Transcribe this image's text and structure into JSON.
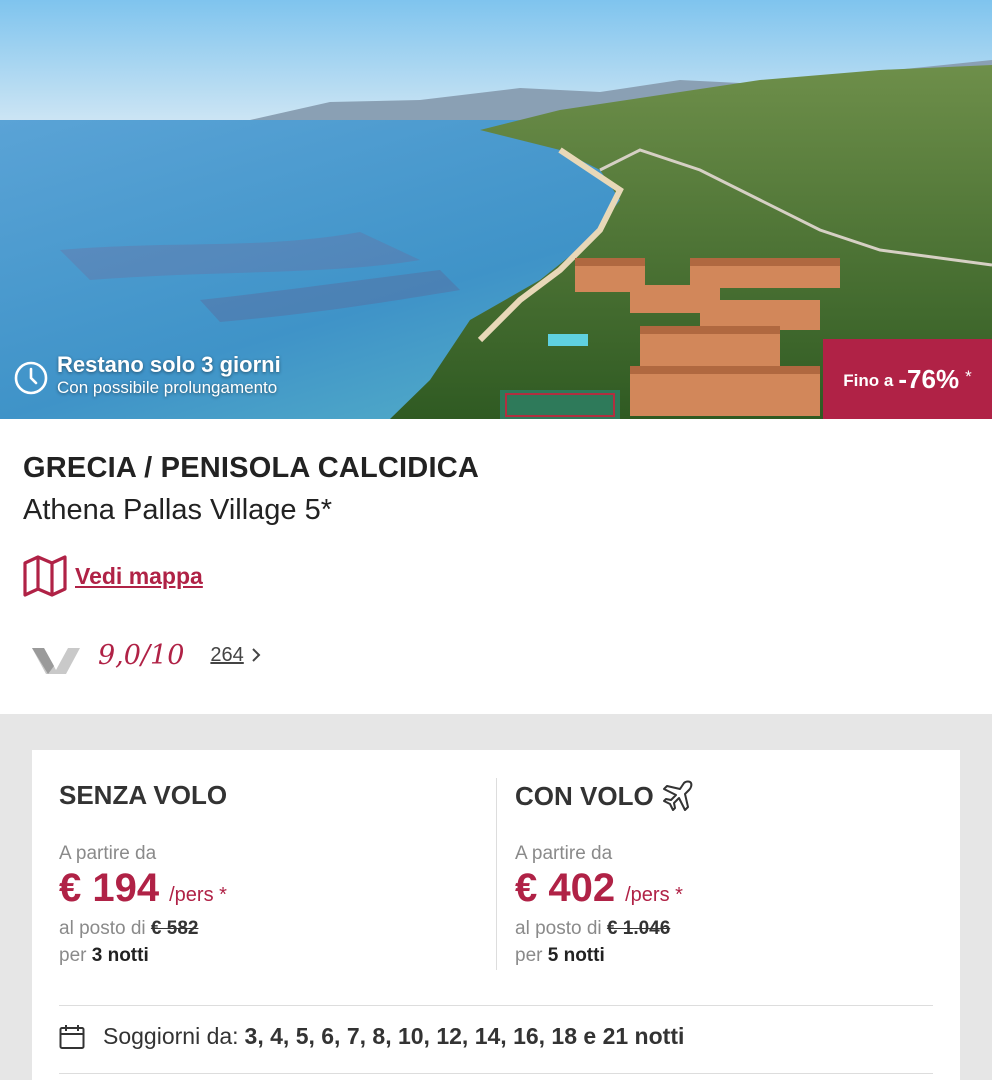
{
  "hero": {
    "timer_title": "Restano solo 3 giorni",
    "timer_subtitle": "Con possibile prolungamento",
    "discount_prefix": "Fino a",
    "discount_value": "-76%",
    "discount_asterisk": "*"
  },
  "offer": {
    "destination": "GRECIA / PENISOLA CALCIDICA",
    "hotel": "Athena Pallas Village 5*",
    "map_link": "Vedi mappa",
    "rating_score": "9,0/10",
    "review_count": "264"
  },
  "pricing": {
    "without_flight": {
      "title": "SENZA VOLO",
      "from_label": "A partire da",
      "price": "€ 194",
      "per_person": "/pers *",
      "instead_of_label": "al posto di",
      "old_price": "€ 582",
      "per_label": "per",
      "nights": "3 notti"
    },
    "with_flight": {
      "title": "CON VOLO",
      "from_label": "A partire da",
      "price": "€ 402",
      "per_person": "/pers *",
      "instead_of_label": "al posto di",
      "old_price": "€ 1.046",
      "per_label": "per",
      "nights": "5 notti"
    },
    "stays_label": "Soggiorni da:",
    "stays_values": "3, 4, 5, 6, 7, 8, 10, 12, 14, 16, 18 e 21 notti"
  },
  "colors": {
    "accent": "#b02246",
    "panel_background": "#e6e6e6"
  },
  "icons": [
    "clock-icon",
    "map-icon",
    "reviews-logo-icon",
    "chevron-right-icon",
    "airplane-icon",
    "calendar-icon"
  ]
}
